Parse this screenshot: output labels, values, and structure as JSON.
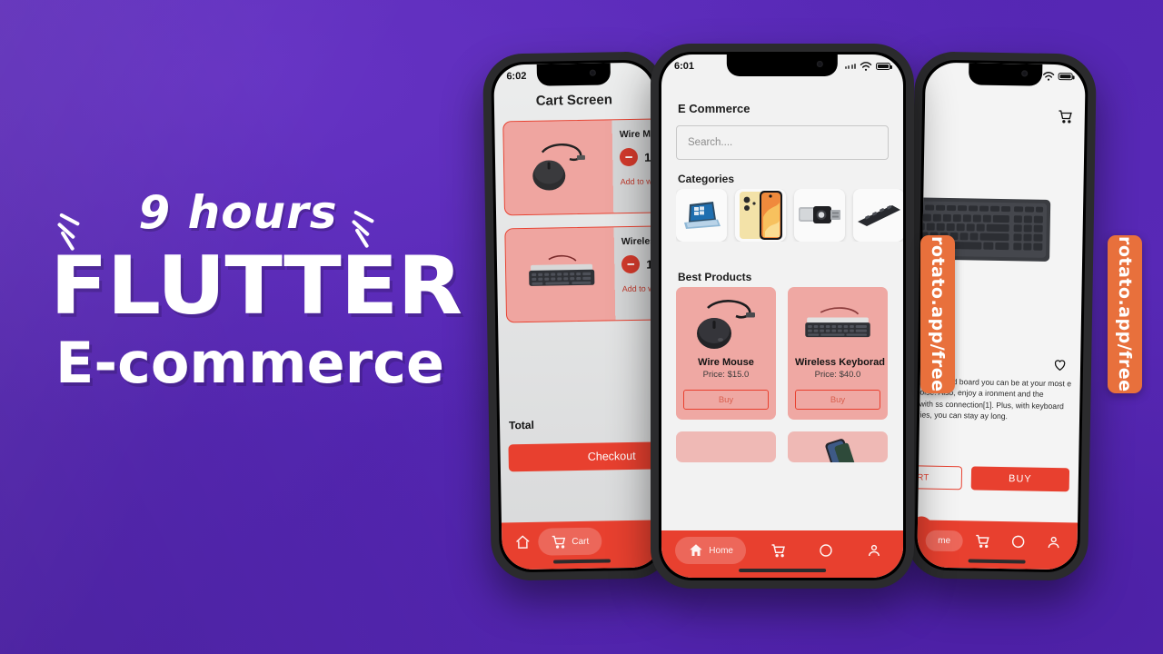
{
  "promo": {
    "duration": "9 hours",
    "title": "FLUTTER",
    "subtitle": "E-commerce"
  },
  "colors": {
    "background_purple": "#5a2ab8",
    "accent_red": "#e8402f",
    "card_pink": "#efa8a3",
    "badge_orange": "#e8703c",
    "text_dark": "#1c1c1c"
  },
  "watermarks": [
    {
      "label": "rotato.app/free"
    },
    {
      "label": "rotato.app/free"
    }
  ],
  "phone_left": {
    "status": {
      "time": "6:02"
    },
    "screen_title": "Cart Screen",
    "items": [
      {
        "name": "Wire Mouse",
        "quantity": "1",
        "decrease_label": "−",
        "increase_label": "+",
        "wishlist_label": "Add to wishlist",
        "image": "mouse-image"
      },
      {
        "name": "Wireless Keyb",
        "quantity": "1",
        "decrease_label": "−",
        "increase_label": "+",
        "wishlist_label": "Add to wishlist",
        "image": "keyboard-image"
      }
    ],
    "total_label": "Total",
    "checkout_label": "Checkout",
    "nav": [
      {
        "icon": "home-icon",
        "label": "",
        "active": false
      },
      {
        "icon": "cart-icon",
        "label": "Cart",
        "active": true
      }
    ]
  },
  "phone_center": {
    "status": {
      "time": "6:01"
    },
    "app_title": "E Commerce",
    "search": {
      "placeholder": "Search....",
      "value": ""
    },
    "categories_title": "Categories",
    "categories": [
      {
        "name": "laptop-category",
        "image": "laptop-image"
      },
      {
        "name": "phone-category",
        "image": "phone-image"
      },
      {
        "name": "usb-category",
        "image": "usb-drive-image"
      },
      {
        "name": "keyboard-category",
        "image": "keyboard-image"
      }
    ],
    "best_products_title": "Best Products",
    "products": [
      {
        "name": "Wire Mouse",
        "price": "Price: $15.0",
        "buy_label": "Buy",
        "image": "mouse-image"
      },
      {
        "name": "Wireless Keyborad",
        "price": "Price: $40.0",
        "buy_label": "Buy",
        "image": "keyboard-image"
      }
    ],
    "products_partial": [
      {
        "image": "product-image"
      },
      {
        "image": "phone-image"
      }
    ],
    "nav": [
      {
        "icon": "home-icon",
        "label": "Home",
        "active": true
      },
      {
        "icon": "cart-icon",
        "label": "",
        "active": false
      },
      {
        "icon": "circle-icon",
        "label": "",
        "active": false
      },
      {
        "icon": "person-icon",
        "label": "",
        "active": false
      }
    ]
  },
  "phone_right": {
    "status": {
      "time": ""
    },
    "product_image": "keyboard-image",
    "description": "hat's comfortable, sleek and board you can be at your most e least amount of noise. Also, enjoy a ironment and the freedom to roam with ss connection[1]. Plus, with keyboard ong-lasting batteries, you can stay ay long.",
    "add_to_cart_label": "D CART",
    "buy_label": "BUY",
    "plus_label": "+",
    "nav": [
      {
        "icon": "home-icon",
        "label": "me",
        "active": true
      },
      {
        "icon": "cart-icon",
        "label": "",
        "active": false
      },
      {
        "icon": "circle-icon",
        "label": "",
        "active": false
      },
      {
        "icon": "person-icon",
        "label": "",
        "active": false
      }
    ]
  }
}
